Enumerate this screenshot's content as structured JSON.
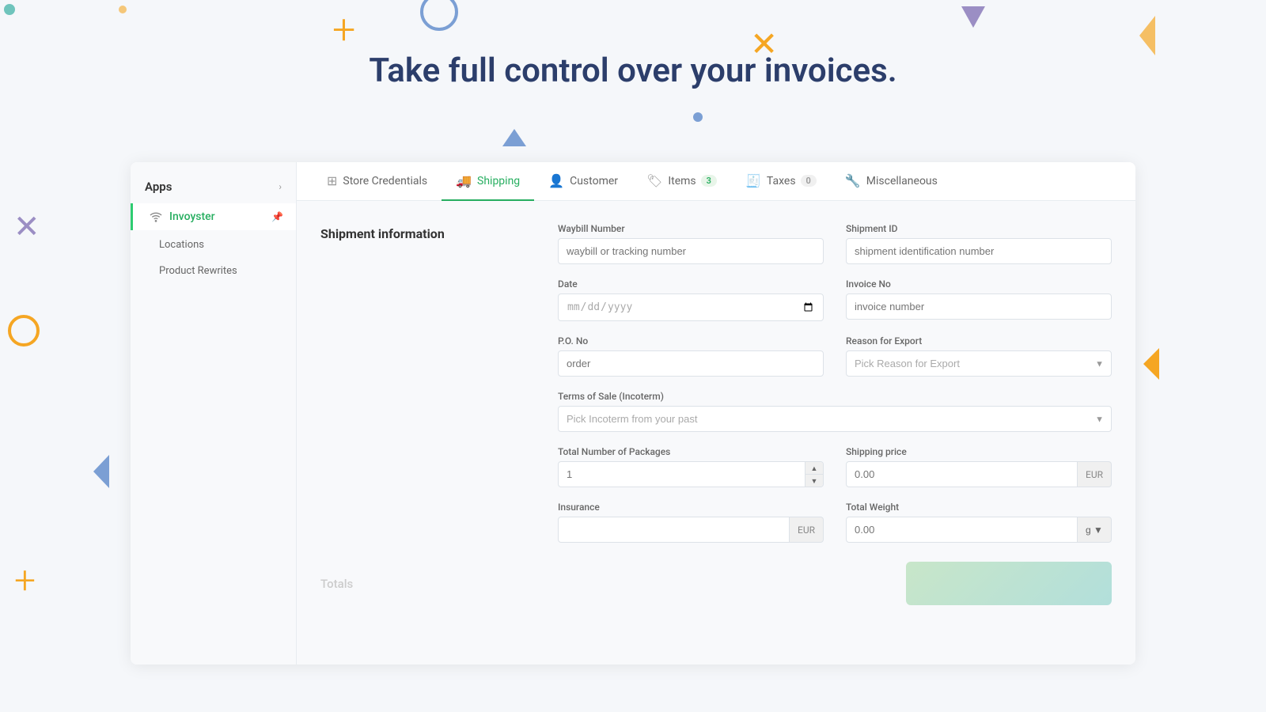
{
  "hero": {
    "text": "Take full control over your invoices."
  },
  "sidebar": {
    "apps_label": "Apps",
    "items": [
      {
        "id": "invoyster",
        "label": "Invoyster",
        "icon": "wifi",
        "active": true,
        "pinned": true
      },
      {
        "id": "locations",
        "label": "Locations",
        "active": false
      },
      {
        "id": "product-rewrites",
        "label": "Product Rewrites",
        "active": false
      }
    ]
  },
  "tabs": [
    {
      "id": "store-credentials",
      "label": "Store Credentials",
      "icon": "store",
      "active": false,
      "badge": null
    },
    {
      "id": "shipping",
      "label": "Shipping",
      "icon": "truck",
      "active": true,
      "badge": null
    },
    {
      "id": "customer",
      "label": "Customer",
      "icon": "person",
      "active": false,
      "badge": null
    },
    {
      "id": "items",
      "label": "Items",
      "icon": "tag",
      "active": false,
      "badge": "3"
    },
    {
      "id": "taxes",
      "label": "Taxes",
      "icon": "receipt",
      "active": false,
      "badge": "0"
    },
    {
      "id": "miscellaneous",
      "label": "Miscellaneous",
      "icon": "wrench",
      "active": false,
      "badge": null
    }
  ],
  "form": {
    "section_title": "Shipment information",
    "fields": {
      "waybill_number": {
        "label": "Waybill Number",
        "placeholder": "waybill or tracking number",
        "value": ""
      },
      "shipment_id": {
        "label": "Shipment ID",
        "placeholder": "shipment identification number",
        "value": ""
      },
      "date": {
        "label": "Date",
        "placeholder": "",
        "value": "",
        "type": "date"
      },
      "invoice_no": {
        "label": "Invoice No",
        "placeholder": "invoice number",
        "value": ""
      },
      "po_no": {
        "label": "P.O. No",
        "placeholder": "order",
        "value": ""
      },
      "reason_for_export": {
        "label": "Reason for Export",
        "placeholder": "Pick Reason for Export",
        "value": ""
      },
      "terms_of_sale": {
        "label": "Terms of Sale (Incoterm)",
        "placeholder": "Pick Incoterm from your past",
        "value": ""
      },
      "total_packages": {
        "label": "Total Number of Packages",
        "placeholder": "1",
        "value": ""
      },
      "shipping_price": {
        "label": "Shipping price",
        "placeholder": "0.00",
        "value": "",
        "addon": "EUR"
      },
      "insurance": {
        "label": "Insurance",
        "placeholder": "",
        "value": "",
        "addon": "EUR"
      },
      "total_weight": {
        "label": "Total Weight",
        "placeholder": "0.00",
        "value": "",
        "addon": "g"
      }
    }
  },
  "totals": {
    "label": "Totals"
  }
}
